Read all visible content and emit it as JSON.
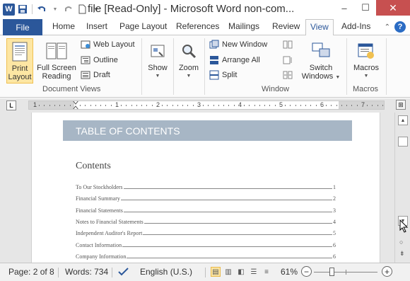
{
  "window": {
    "title": "file [Read-Only]  -  Microsoft Word non-com...",
    "controls": [
      "minimize-icon",
      "restore-icon",
      "close-icon"
    ]
  },
  "qat": {
    "app_logo": "W",
    "icons": [
      "save-icon",
      "undo-icon",
      "redo-icon",
      "new-doc-icon",
      "customize-icon"
    ]
  },
  "tabs": {
    "file": "File",
    "items": [
      "Home",
      "Insert",
      "Page Layout",
      "References",
      "Mailings",
      "Review",
      "View",
      "Add-Ins"
    ],
    "active": "View"
  },
  "ribbon": {
    "document_views": {
      "label": "Document Views",
      "print_layout": "Print Layout",
      "print_layout_l1": "Print",
      "print_layout_l2": "Layout",
      "full_screen_l1": "Full Screen",
      "full_screen_l2": "Reading",
      "web_layout": "Web Layout",
      "outline": "Outline",
      "draft": "Draft"
    },
    "show": {
      "label": "Show"
    },
    "zoom": {
      "label": "Zoom"
    },
    "window": {
      "label": "Window",
      "new_window": "New Window",
      "arrange_all": "Arrange All",
      "split": "Split",
      "switch_l1": "Switch",
      "switch_l2": "Windows"
    },
    "macros": {
      "label": "Macros",
      "button": "Macros"
    }
  },
  "ruler": {
    "numbers": [
      "1",
      "1",
      "2",
      "3",
      "4",
      "5",
      "6",
      "7"
    ]
  },
  "document": {
    "banner": "TABLE OF CONTENTS",
    "heading": "Contents",
    "toc": [
      {
        "label": "To Our Stockholders",
        "page": "1"
      },
      {
        "label": "Financial Summary",
        "page": "2"
      },
      {
        "label": "Financial Statements",
        "page": "3"
      },
      {
        "label": "Notes to Financial Statements",
        "page": "4"
      },
      {
        "label": "Independent Auditor's Report",
        "page": "5"
      },
      {
        "label": "Contact Information",
        "page": "6"
      },
      {
        "label": "Company Information",
        "page": "6"
      }
    ]
  },
  "status": {
    "page": "Page: 2 of 8",
    "words": "Words: 734",
    "language": "English (U.S.)",
    "zoom": "61%"
  },
  "colors": {
    "accent": "#2b579a",
    "banner": "#a7b6c5",
    "close": "#c75050",
    "selected": "#fde6a3"
  }
}
